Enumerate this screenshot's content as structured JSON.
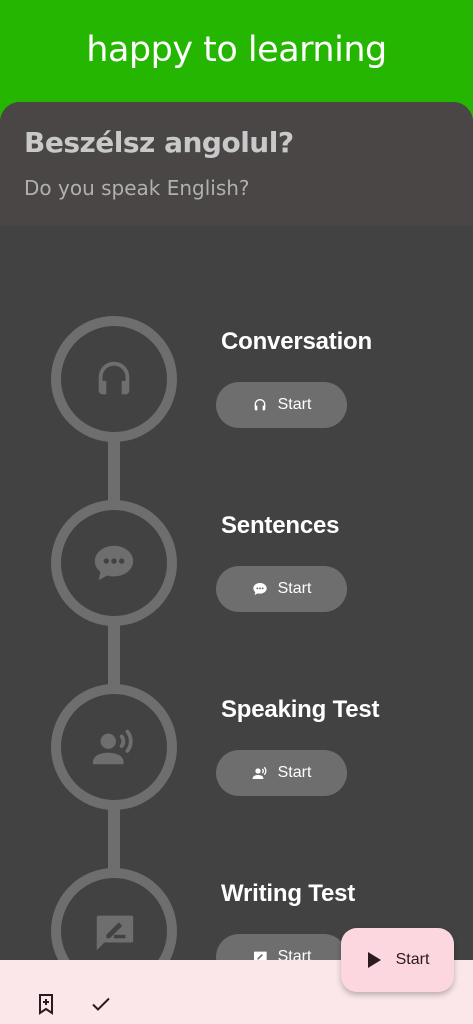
{
  "app_title": "happy to learning",
  "heading": "Beszélsz angolul?",
  "subheading": "Do you speak English?",
  "steps": [
    {
      "title": "Conversation",
      "button_label": "Start",
      "icon": "headphones-icon"
    },
    {
      "title": "Sentences",
      "button_label": "Start",
      "icon": "chat-bubble-icon"
    },
    {
      "title": "Speaking Test",
      "button_label": "Start",
      "icon": "speaking-person-icon"
    },
    {
      "title": "Writing Test",
      "button_label": "Start",
      "icon": "writing-icon"
    }
  ],
  "fab": {
    "label": "Start",
    "icon": "play-icon"
  },
  "bottom_bar": {
    "icons": [
      "bookmark-add-icon",
      "check-icon"
    ]
  },
  "colors": {
    "app_bar": "#24b600",
    "card": "#424242",
    "step_gray": "#6e6e6e",
    "bottom_bar": "#fbe7ea",
    "fab": "#fdd7e0"
  }
}
